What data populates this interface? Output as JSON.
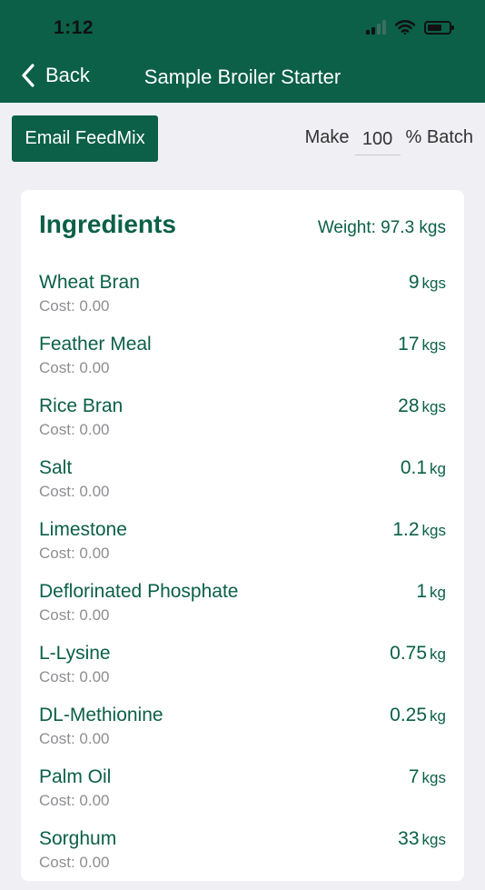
{
  "status": {
    "time": "1:12"
  },
  "nav": {
    "back_label": "Back",
    "title": "Sample Broiler Starter"
  },
  "toolbar": {
    "email_label": "Email FeedMix",
    "make_label": "Make",
    "batch_value": "100",
    "batch_suffix": "% Batch"
  },
  "ingredients": {
    "title": "Ingredients",
    "weight_label": "Weight: 97.3 kgs",
    "items": [
      {
        "name": "Wheat Bran",
        "cost": "Cost: 0.00",
        "qty": "9",
        "unit": "kgs"
      },
      {
        "name": "Feather Meal",
        "cost": "Cost: 0.00",
        "qty": "17",
        "unit": "kgs"
      },
      {
        "name": "Rice Bran",
        "cost": "Cost: 0.00",
        "qty": "28",
        "unit": "kgs"
      },
      {
        "name": "Salt",
        "cost": "Cost: 0.00",
        "qty": "0.1",
        "unit": "kg"
      },
      {
        "name": "Limestone",
        "cost": "Cost: 0.00",
        "qty": "1.2",
        "unit": "kgs"
      },
      {
        "name": "Deflorinated Phosphate",
        "cost": "Cost: 0.00",
        "qty": "1",
        "unit": "kg"
      },
      {
        "name": "L-Lysine",
        "cost": "Cost: 0.00",
        "qty": "0.75",
        "unit": "kg"
      },
      {
        "name": "DL-Methionine",
        "cost": "Cost: 0.00",
        "qty": "0.25",
        "unit": "kg"
      },
      {
        "name": "Palm Oil",
        "cost": "Cost: 0.00",
        "qty": "7",
        "unit": "kgs"
      },
      {
        "name": "Sorghum",
        "cost": "Cost: 0.00",
        "qty": "33",
        "unit": "kgs"
      }
    ]
  },
  "colors": {
    "primary": "#0b6047",
    "background": "#efeff4",
    "muted": "#8e8e93"
  }
}
